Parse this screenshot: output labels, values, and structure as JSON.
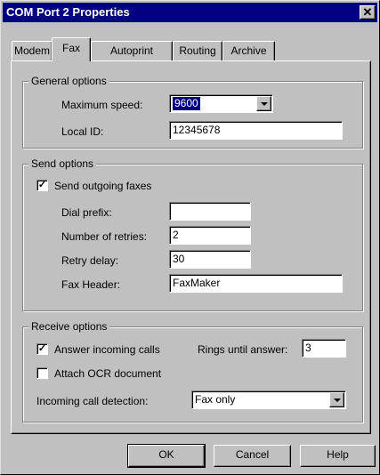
{
  "window": {
    "title": "COM Port 2 Properties",
    "close_glyph": "✕"
  },
  "tabs": [
    {
      "label": "Modem"
    },
    {
      "label": "Fax",
      "active": true
    },
    {
      "label": "Autoprint"
    },
    {
      "label": "Routing"
    },
    {
      "label": "Archive"
    }
  ],
  "general": {
    "title": "General options",
    "max_speed_label": "Maximum speed:",
    "max_speed_value": "9600",
    "local_id_label": "Local ID:",
    "local_id_value": "12345678"
  },
  "send": {
    "title": "Send options",
    "send_outgoing_label": "Send outgoing faxes",
    "send_outgoing_checked": true,
    "dial_prefix_label": "Dial prefix:",
    "dial_prefix_value": "",
    "retries_label": "Number of retries:",
    "retries_value": "2",
    "retry_delay_label": "Retry delay:",
    "retry_delay_value": "30",
    "fax_header_label": "Fax Header:",
    "fax_header_value": "FaxMaker"
  },
  "receive": {
    "title": "Receive options",
    "answer_label": "Answer incoming calls",
    "answer_checked": true,
    "rings_label": "Rings until answer:",
    "rings_value": "3",
    "ocr_label": "Attach OCR document",
    "ocr_checked": false,
    "detection_label": "Incoming call detection:",
    "detection_value": "Fax only"
  },
  "buttons": {
    "ok": "OK",
    "cancel": "Cancel",
    "help": "Help"
  },
  "check_glyph": "✓"
}
